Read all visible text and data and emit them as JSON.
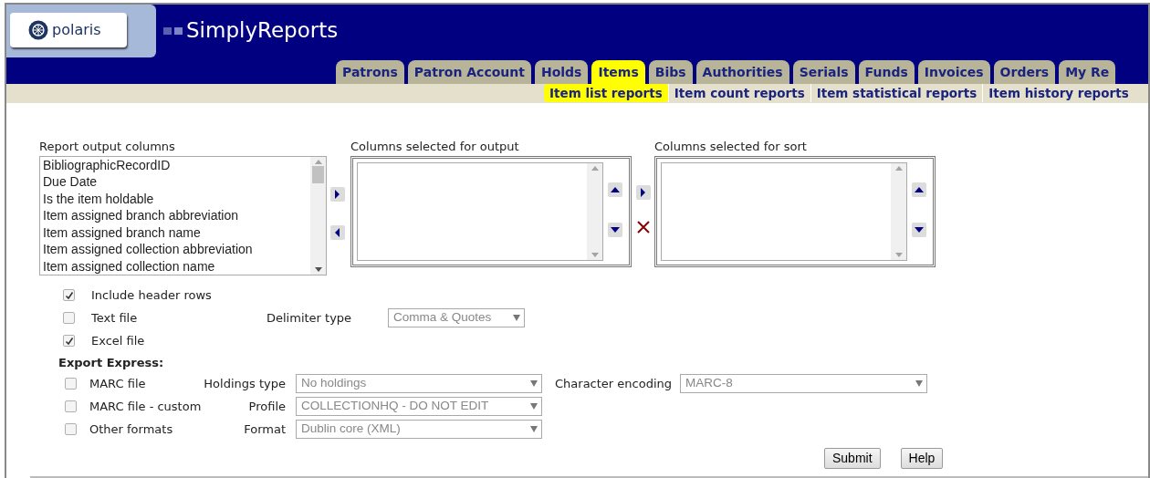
{
  "header": {
    "logo": "polaris",
    "title": "SimplyReports"
  },
  "tabs": [
    {
      "label": "Patrons",
      "selected": false
    },
    {
      "label": "Patron Account",
      "selected": false
    },
    {
      "label": "Holds",
      "selected": false
    },
    {
      "label": "Items",
      "selected": true
    },
    {
      "label": "Bibs",
      "selected": false
    },
    {
      "label": "Authorities",
      "selected": false
    },
    {
      "label": "Serials",
      "selected": false
    },
    {
      "label": "Funds",
      "selected": false
    },
    {
      "label": "Invoices",
      "selected": false
    },
    {
      "label": "Orders",
      "selected": false
    },
    {
      "label": "My Re",
      "selected": false
    }
  ],
  "subtabs": [
    {
      "label": "Item list reports",
      "selected": true
    },
    {
      "label": "Item count reports",
      "selected": false
    },
    {
      "label": "Item statistical reports",
      "selected": false
    },
    {
      "label": "Item history reports",
      "selected": false
    }
  ],
  "lists": {
    "available": {
      "label": "Report output columns",
      "items": [
        "BibliographicRecordID",
        "Due Date",
        "Is the item holdable",
        "Item assigned branch abbreviation",
        "Item assigned branch name",
        "Item assigned collection abbreviation",
        "Item assigned collection name"
      ]
    },
    "output": {
      "label": "Columns selected for output"
    },
    "sort": {
      "label": "Columns selected for sort"
    }
  },
  "options": [
    {
      "label": "Include header rows",
      "checked": true
    },
    {
      "label": "Text file",
      "checked": false,
      "field_label": "Delimiter type",
      "select": {
        "value": "Comma & Quotes",
        "disabled": true
      }
    },
    {
      "label": "Excel file",
      "checked": true
    }
  ],
  "export_express": {
    "title": "Export Express:",
    "rows": [
      {
        "label": "MARC file",
        "checked": false,
        "field_label": "Holdings type",
        "select": {
          "value": "No holdings",
          "disabled": true
        },
        "extra_label": "Character encoding",
        "extra_select": {
          "value": "MARC-8",
          "disabled": true
        }
      },
      {
        "label": "MARC file - custom",
        "checked": false,
        "field_label": "Profile",
        "select": {
          "value": "COLLECTIONHQ - DO NOT EDIT",
          "disabled": true
        }
      },
      {
        "label": "Other formats",
        "checked": false,
        "field_label": "Format",
        "select": {
          "value": "Dublin core (XML)",
          "disabled": true
        }
      }
    ]
  },
  "buttons": [
    "Submit",
    "Help"
  ]
}
